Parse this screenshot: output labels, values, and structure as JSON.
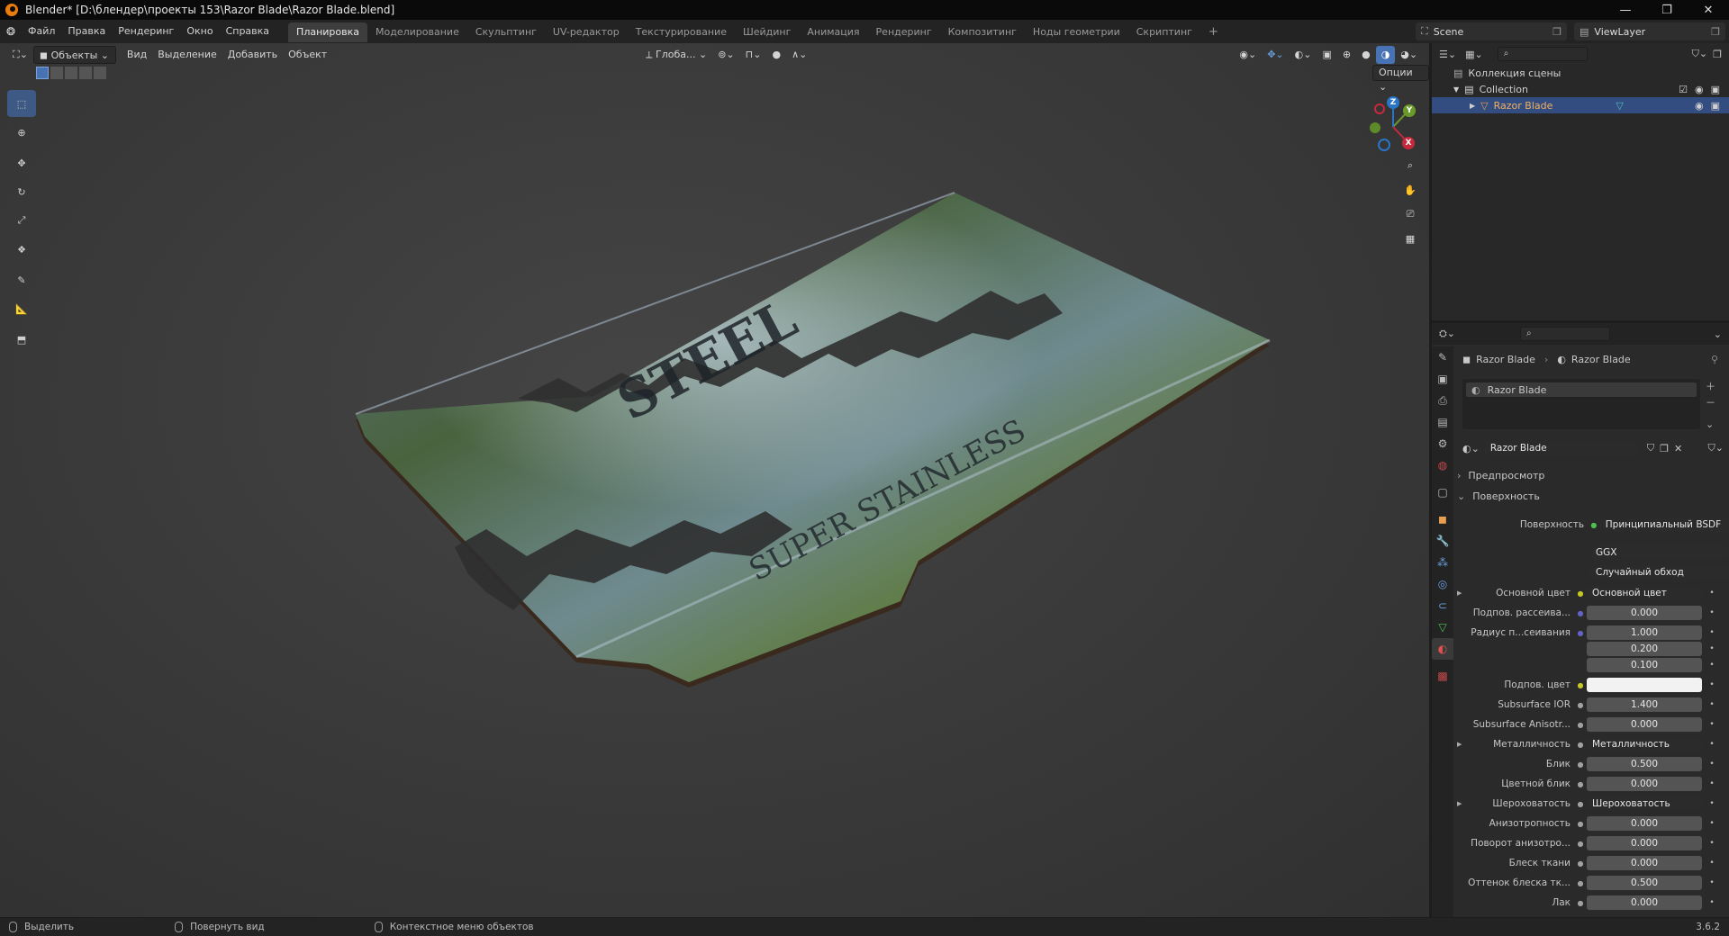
{
  "window": {
    "title": "Blender* [D:\\блендер\\проекты 153\\Razor Blade\\Razor Blade.blend]",
    "controls": [
      "—",
      "❐",
      "✕"
    ]
  },
  "menu": [
    "Файл",
    "Правка",
    "Рендеринг",
    "Окно",
    "Справка"
  ],
  "workspaces": {
    "tabs": [
      "Планировка",
      "Моделирование",
      "Скульптинг",
      "UV-редактор",
      "Текстурирование",
      "Шейдинг",
      "Анимация",
      "Рендеринг",
      "Композитинг",
      "Ноды геометрии",
      "Скриптинг"
    ],
    "active": "Планировка",
    "add": "+"
  },
  "scene": {
    "name": "Scene",
    "view_layer": "ViewLayer"
  },
  "viewport_header": {
    "mode": "Объекты",
    "items": [
      "Вид",
      "Выделение",
      "Добавить",
      "Объект"
    ],
    "orientation": "Глоба...",
    "options": "Опции"
  },
  "blade": {
    "text_top": "STEEL",
    "text_bottom": "SUPER STAINLESS"
  },
  "gizmo": {
    "x": "X",
    "y": "Y",
    "z": "Z"
  },
  "outliner": {
    "root": "Коллекция сцены",
    "collection": "Collection",
    "object": "Razor Blade"
  },
  "properties": {
    "breadcrumb_object": "Razor Blade",
    "breadcrumb_material": "Razor Blade",
    "slot_name": "Razor Blade",
    "material_name": "Razor Blade",
    "panel_preview": "Предпросмотр",
    "panel_surface": "Поверхность",
    "surface_label": "Поверхность",
    "surface_value": "Принципиальный BSDF",
    "distribution": "GGX",
    "subsurface_method": "Случайный обход",
    "rows": [
      {
        "label": "Основной цвет",
        "kind": "link",
        "value": "Основной цвет",
        "dot": "#c7c729",
        "expand": true
      },
      {
        "label": "Подпов. рассеива...",
        "kind": "num",
        "value": "0.000",
        "fill": 0,
        "dot": "#6363c7"
      },
      {
        "label": "Радиус п...сеивания",
        "kind": "num",
        "value": "1.000",
        "fill": 0,
        "dot": "#6363c7"
      },
      {
        "label": "",
        "kind": "num",
        "value": "0.200",
        "fill": 0,
        "dot": ""
      },
      {
        "label": "",
        "kind": "num",
        "value": "0.100",
        "fill": 0,
        "dot": ""
      },
      {
        "label": "Подпов. цвет",
        "kind": "color",
        "value": "",
        "color": "#f2f2f2",
        "dot": "#c7c729"
      },
      {
        "label": "Subsurface IOR",
        "kind": "num",
        "value": "1.400",
        "fill": 0.12,
        "dot": "#a1a1a1"
      },
      {
        "label": "Subsurface Anisotr...",
        "kind": "num",
        "value": "0.000",
        "fill": 0,
        "dot": "#a1a1a1"
      },
      {
        "label": "Металличность",
        "kind": "link",
        "value": "Металличность",
        "dot": "#a1a1a1",
        "expand": true
      },
      {
        "label": "Блик",
        "kind": "num",
        "value": "0.500",
        "fill": 0.5,
        "dot": "#a1a1a1"
      },
      {
        "label": "Цветной блик",
        "kind": "num",
        "value": "0.000",
        "fill": 0,
        "dot": "#a1a1a1"
      },
      {
        "label": "Шероховатость",
        "kind": "link",
        "value": "Шероховатость",
        "dot": "#a1a1a1",
        "expand": true
      },
      {
        "label": "Анизотропность",
        "kind": "num",
        "value": "0.000",
        "fill": 0,
        "dot": "#a1a1a1"
      },
      {
        "label": "Поворот анизотро...",
        "kind": "num",
        "value": "0.000",
        "fill": 0,
        "dot": "#a1a1a1"
      },
      {
        "label": "Блеск ткани",
        "kind": "num",
        "value": "0.000",
        "fill": 0,
        "dot": "#a1a1a1"
      },
      {
        "label": "Оттенок блеска тк...",
        "kind": "num",
        "value": "0.500",
        "fill": 0.5,
        "dot": "#a1a1a1"
      },
      {
        "label": "Лак",
        "kind": "num",
        "value": "0.000",
        "fill": 0,
        "dot": "#a1a1a1"
      }
    ]
  },
  "statusbar": {
    "select": "Выделить",
    "rotate": "Повернуть вид",
    "context": "Контекстное меню объектов",
    "version": "3.6.2"
  },
  "colors": {
    "accent": "#4772b3",
    "selection": "#334d80",
    "active_tool": "#3e5a84",
    "blender_orange": "#e87d0d"
  }
}
